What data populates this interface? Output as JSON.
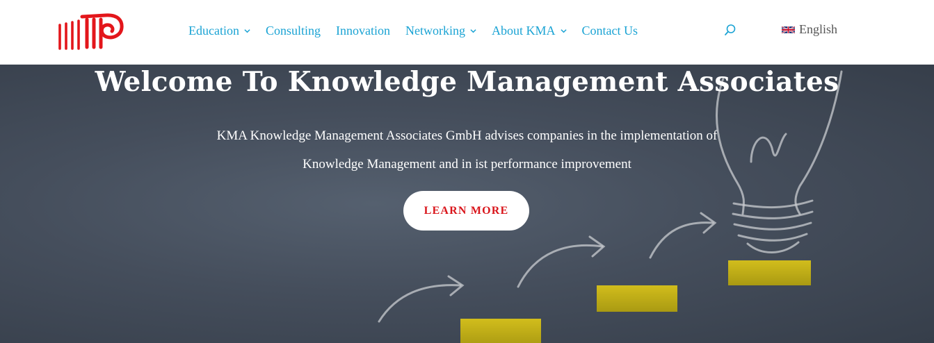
{
  "brand": {
    "logo_icon": "kma-logo-icon",
    "accent_color": "#e3161b"
  },
  "nav": {
    "color": "#1aa3d4",
    "items": [
      {
        "label": "Education",
        "has_dropdown": true
      },
      {
        "label": "Consulting",
        "has_dropdown": false
      },
      {
        "label": "Innovation",
        "has_dropdown": false
      },
      {
        "label": "Networking",
        "has_dropdown": true
      },
      {
        "label": "About KMA",
        "has_dropdown": true
      },
      {
        "label": "Contact Us",
        "has_dropdown": false
      }
    ],
    "search_icon": "search-icon"
  },
  "language": {
    "label": "English",
    "flag_icon": "uk-flag-icon"
  },
  "hero": {
    "title": "Welcome To Knowledge Management Associates",
    "subtitle_line1": "KMA Knowledge Management Associates GmbH advises companies in the implementation of",
    "subtitle_line2": "Knowledge Management and in ist performance improvement",
    "cta_label": "LEARN MORE",
    "cta_color": "#d9151b",
    "background_image": "chalkboard-lightbulb-steps-image"
  }
}
